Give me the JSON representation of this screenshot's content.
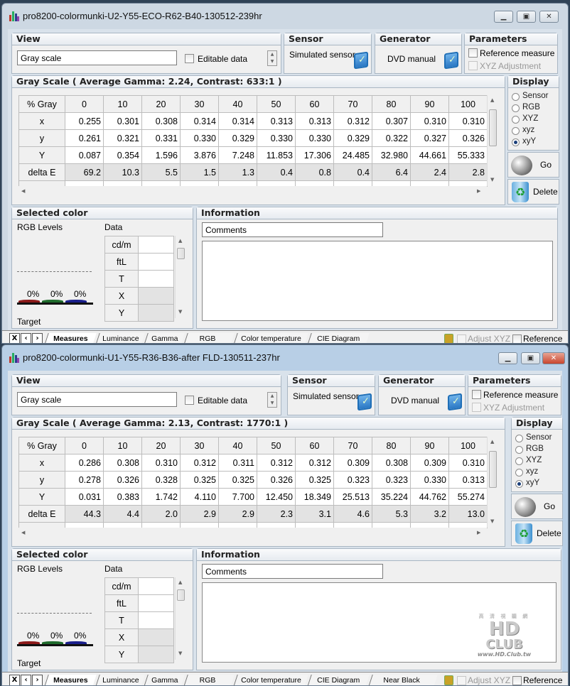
{
  "colors": {
    "red": "#8b1a1a",
    "green": "#1f6b2c",
    "blue": "#1a1f8b",
    "accent": "#1f6fb7"
  },
  "windows": [
    {
      "title": "pro8200-colormunki-U2-Y55-ECO-R62-B40-130512-239hr",
      "state": "inactive",
      "view": {
        "header": "View",
        "combo": "Gray scale",
        "editable": "Editable data"
      },
      "sensor": {
        "header": "Sensor",
        "label": "Simulated sensor"
      },
      "generator": {
        "header": "Generator",
        "label": "DVD manual"
      },
      "parameters": {
        "header": "Parameters",
        "reference": "Reference measure",
        "xyz": "XYZ Adjustment"
      },
      "grayscale": {
        "header": "Gray Scale ( Average Gamma: 2.24, Contrast: 633:1 )",
        "columns": [
          "% Gray",
          "0",
          "10",
          "20",
          "30",
          "40",
          "50",
          "60",
          "70",
          "80",
          "90",
          "100"
        ],
        "rows": [
          {
            "label": "x",
            "values": [
              "0.255",
              "0.301",
              "0.308",
              "0.314",
              "0.314",
              "0.313",
              "0.313",
              "0.312",
              "0.307",
              "0.310",
              "0.310"
            ]
          },
          {
            "label": "y",
            "values": [
              "0.261",
              "0.321",
              "0.331",
              "0.330",
              "0.329",
              "0.330",
              "0.330",
              "0.329",
              "0.322",
              "0.327",
              "0.326"
            ]
          },
          {
            "label": "Y",
            "values": [
              "0.087",
              "0.354",
              "1.596",
              "3.876",
              "7.248",
              "11.853",
              "17.306",
              "24.485",
              "32.980",
              "44.661",
              "55.333"
            ]
          },
          {
            "label": "delta E",
            "values": [
              "69.2",
              "10.3",
              "5.5",
              "1.5",
              "1.3",
              "0.4",
              "0.8",
              "0.4",
              "6.4",
              "2.4",
              "2.8"
            ]
          }
        ]
      },
      "display": {
        "header": "Display",
        "options": [
          "Sensor",
          "RGB",
          "XYZ",
          "xyz",
          "xyY"
        ],
        "selected": "xyY"
      },
      "go": "Go",
      "delete": "Delete",
      "selected_color": {
        "header": "Selected color",
        "rgb_levels": "RGB Levels",
        "data": "Data",
        "levels": [
          "0%",
          "0%",
          "0%"
        ],
        "target": "Target",
        "data_rows": [
          "cd/m",
          "ftL",
          "T",
          "X",
          "Y"
        ]
      },
      "information": {
        "header": "Information",
        "combo": "Comments"
      },
      "tabs": [
        "Measures",
        "Luminance",
        "Gamma",
        "RGB Levels",
        "Color temperature",
        "CIE Diagram"
      ],
      "selected_tab": "Measures",
      "adjust_xyz": "Adjust XYZ",
      "reference": "Reference"
    },
    {
      "title": "pro8200-colormunki-U1-Y55-R36-B36-after FLD-130511-237hr",
      "state": "active",
      "view": {
        "header": "View",
        "combo": "Gray scale",
        "editable": "Editable data"
      },
      "sensor": {
        "header": "Sensor",
        "label": "Simulated sensor"
      },
      "generator": {
        "header": "Generator",
        "label": "DVD manual"
      },
      "parameters": {
        "header": "Parameters",
        "reference": "Reference measure",
        "xyz": "XYZ Adjustment"
      },
      "grayscale": {
        "header": "Gray Scale ( Average Gamma: 2.13, Contrast: 1770:1 )",
        "columns": [
          "% Gray",
          "0",
          "10",
          "20",
          "30",
          "40",
          "50",
          "60",
          "70",
          "80",
          "90",
          "100"
        ],
        "rows": [
          {
            "label": "x",
            "values": [
              "0.286",
              "0.308",
              "0.310",
              "0.312",
              "0.311",
              "0.312",
              "0.312",
              "0.309",
              "0.308",
              "0.309",
              "0.310"
            ]
          },
          {
            "label": "y",
            "values": [
              "0.278",
              "0.326",
              "0.328",
              "0.325",
              "0.325",
              "0.326",
              "0.325",
              "0.323",
              "0.323",
              "0.330",
              "0.313"
            ]
          },
          {
            "label": "Y",
            "values": [
              "0.031",
              "0.383",
              "1.742",
              "4.110",
              "7.700",
              "12.450",
              "18.349",
              "25.513",
              "35.224",
              "44.762",
              "55.274"
            ]
          },
          {
            "label": "delta E",
            "values": [
              "44.3",
              "4.4",
              "2.0",
              "2.9",
              "2.9",
              "2.3",
              "3.1",
              "4.6",
              "5.3",
              "3.2",
              "13.0"
            ]
          }
        ]
      },
      "display": {
        "header": "Display",
        "options": [
          "Sensor",
          "RGB",
          "XYZ",
          "xyz",
          "xyY"
        ],
        "selected": "xyY"
      },
      "go": "Go",
      "delete": "Delete",
      "selected_color": {
        "header": "Selected color",
        "rgb_levels": "RGB Levels",
        "data": "Data",
        "levels": [
          "0%",
          "0%",
          "0%"
        ],
        "target": "Target",
        "data_rows": [
          "cd/m",
          "ftL",
          "T",
          "X",
          "Y"
        ]
      },
      "information": {
        "header": "Information",
        "combo": "Comments"
      },
      "tabs": [
        "Measures",
        "Luminance",
        "Gamma",
        "RGB Levels",
        "Color temperature",
        "CIE Diagram",
        "Near Black Scale"
      ],
      "selected_tab": "Measures",
      "adjust_xyz": "Adjust XYZ",
      "reference": "Reference",
      "watermark": {
        "top": "高 清 視 聽 網",
        "logo": "HD CLUB",
        "url": "www.HD.Club.tw"
      }
    }
  ]
}
